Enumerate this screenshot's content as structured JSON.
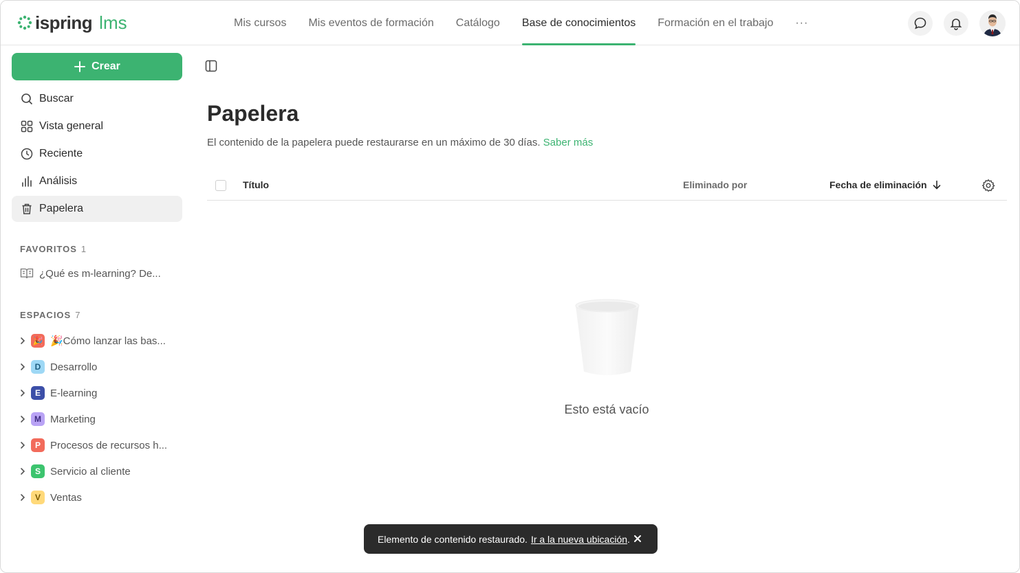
{
  "brand": {
    "name": "ispring",
    "suffix": "lms"
  },
  "nav": {
    "items": [
      {
        "label": "Mis cursos"
      },
      {
        "label": "Mis eventos de formación"
      },
      {
        "label": "Catálogo"
      },
      {
        "label": "Base de conocimientos",
        "active": true
      },
      {
        "label": "Formación en el trabajo"
      }
    ],
    "more": "···"
  },
  "sidebar": {
    "create_label": "Crear",
    "menu": [
      {
        "label": "Buscar",
        "icon": "search-icon"
      },
      {
        "label": "Vista general",
        "icon": "grid-icon"
      },
      {
        "label": "Reciente",
        "icon": "clock-icon"
      },
      {
        "label": "Análisis",
        "icon": "chart-icon"
      },
      {
        "label": "Papelera",
        "icon": "trash-icon",
        "active": true
      }
    ],
    "favorites": {
      "title": "FAVORITOS",
      "count": "1",
      "items": [
        {
          "label": "¿Qué es m-learning? De..."
        }
      ]
    },
    "spaces": {
      "title": "ESPACIOS",
      "count": "7",
      "items": [
        {
          "badge": "🎉",
          "label": "🎉Cómo lanzar las bas...",
          "color": "#f26b5b",
          "text_color": "#fff"
        },
        {
          "badge": "D",
          "label": "Desarrollo",
          "color": "#9ed8f5",
          "text_color": "#1f5e80"
        },
        {
          "badge": "E",
          "label": "E-learning",
          "color": "#3c4fa8",
          "text_color": "#fff"
        },
        {
          "badge": "M",
          "label": "Marketing",
          "color": "#b9a3f5",
          "text_color": "#3d2a80"
        },
        {
          "badge": "P",
          "label": "Procesos de recursos h...",
          "color": "#f26b5b",
          "text_color": "#fff"
        },
        {
          "badge": "S",
          "label": "Servicio al cliente",
          "color": "#3cc46e",
          "text_color": "#fff"
        },
        {
          "badge": "V",
          "label": "Ventas",
          "color": "#ffd97a",
          "text_color": "#7a5a00"
        }
      ]
    }
  },
  "main": {
    "title": "Papelera",
    "description": "El contenido de la papelera puede restaurarse en un máximo de 30 días.",
    "learn_more": "Saber más",
    "columns": {
      "title": "Título",
      "deleted_by": "Eliminado por",
      "deleted_date": "Fecha de eliminación"
    },
    "empty_text": "Esto está vacío"
  },
  "toast": {
    "message": "Elemento de contenido restaurado.",
    "link": "Ir a la nueva ubicación",
    "after": "."
  },
  "colors": {
    "accent": "#3cb371",
    "toast_bg": "#2b2b2b"
  }
}
